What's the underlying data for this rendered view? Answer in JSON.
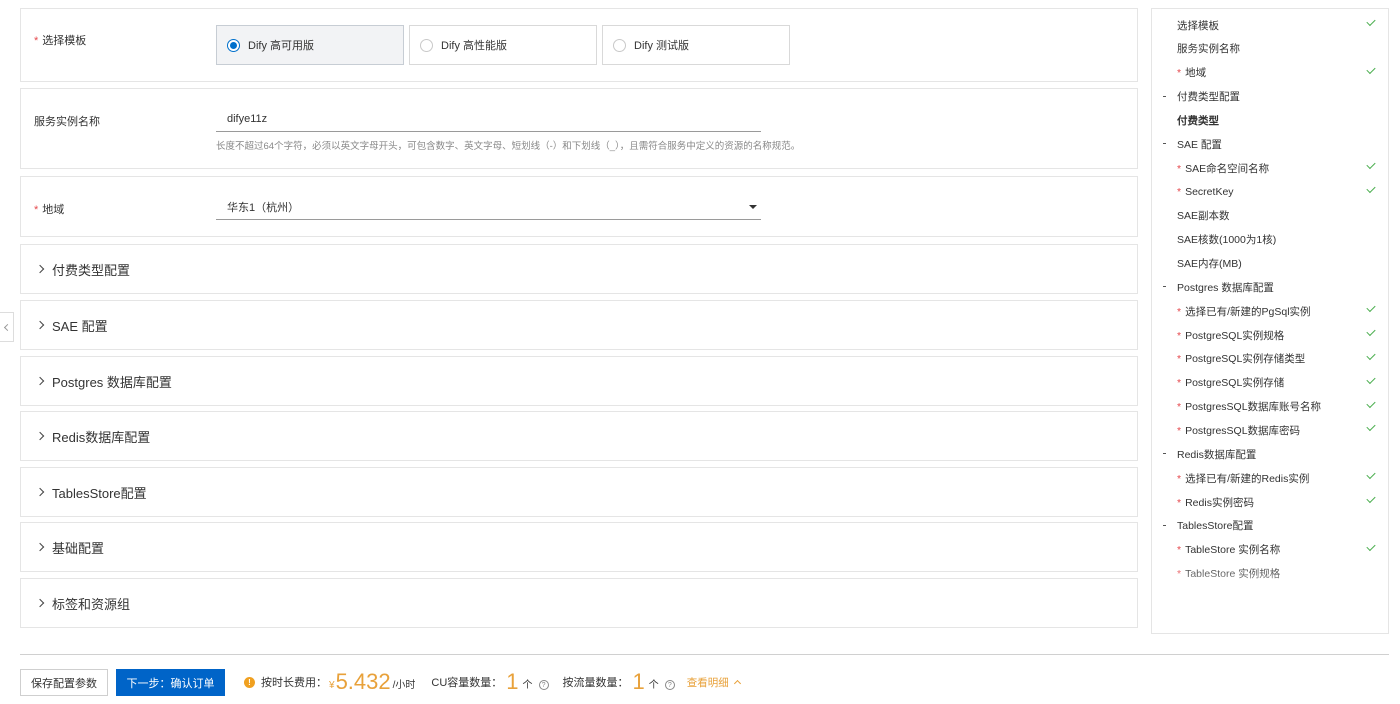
{
  "template": {
    "label": "选择模板",
    "options": [
      {
        "label": "Dify 高可用版",
        "selected": true
      },
      {
        "label": "Dify 高性能版",
        "selected": false
      },
      {
        "label": "Dify 测试版",
        "selected": false
      }
    ]
  },
  "instance_name": {
    "label": "服务实例名称",
    "value": "difye11z",
    "hint": "长度不超过64个字符，必须以英文字母开头，可包含数字、英文字母、短划线（-）和下划线（_），且需符合服务中定义的资源的名称规范。"
  },
  "region": {
    "label": "地域",
    "value": "华东1（杭州）"
  },
  "sections": [
    {
      "label": "付费类型配置"
    },
    {
      "label": "SAE 配置"
    },
    {
      "label": "Postgres 数据库配置"
    },
    {
      "label": "Redis数据库配置"
    },
    {
      "label": "TablesStore配置"
    },
    {
      "label": "基础配置"
    },
    {
      "label": "标签和资源组"
    }
  ],
  "nav": {
    "items": [
      {
        "label": "选择模板",
        "required": false,
        "checked": true,
        "group": false,
        "bold": false
      },
      {
        "label": "服务实例名称",
        "required": false,
        "checked": false,
        "group": false,
        "bold": false
      },
      {
        "label": "地域",
        "required": true,
        "checked": true,
        "group": false,
        "bold": false
      },
      {
        "label": "付费类型配置",
        "required": false,
        "checked": false,
        "group": true,
        "bold": false
      },
      {
        "label": "付费类型",
        "required": false,
        "checked": false,
        "group": false,
        "bold": true
      },
      {
        "label": "SAE 配置",
        "required": false,
        "checked": false,
        "group": true,
        "bold": false
      },
      {
        "label": "SAE命名空间名称",
        "required": true,
        "checked": true,
        "group": false,
        "bold": false
      },
      {
        "label": "SecretKey",
        "required": true,
        "checked": true,
        "group": false,
        "bold": false
      },
      {
        "label": "SAE副本数",
        "required": false,
        "checked": false,
        "group": false,
        "bold": false
      },
      {
        "label": "SAE核数(1000为1核)",
        "required": false,
        "checked": false,
        "group": false,
        "bold": false
      },
      {
        "label": "SAE内存(MB)",
        "required": false,
        "checked": false,
        "group": false,
        "bold": false
      },
      {
        "label": "Postgres 数据库配置",
        "required": false,
        "checked": false,
        "group": true,
        "bold": false
      },
      {
        "label": "选择已有/新建的PgSql实例",
        "required": true,
        "checked": true,
        "group": false,
        "bold": false
      },
      {
        "label": "PostgreSQL实例规格",
        "required": true,
        "checked": true,
        "group": false,
        "bold": false
      },
      {
        "label": "PostgreSQL实例存储类型",
        "required": true,
        "checked": true,
        "group": false,
        "bold": false
      },
      {
        "label": "PostgreSQL实例存储",
        "required": true,
        "checked": true,
        "group": false,
        "bold": false
      },
      {
        "label": "PostgresSQL数据库账号名称",
        "required": true,
        "checked": true,
        "group": false,
        "bold": false
      },
      {
        "label": "PostgresSQL数据库密码",
        "required": true,
        "checked": true,
        "group": false,
        "bold": false
      },
      {
        "label": "Redis数据库配置",
        "required": false,
        "checked": false,
        "group": true,
        "bold": false
      },
      {
        "label": "选择已有/新建的Redis实例",
        "required": true,
        "checked": true,
        "group": false,
        "bold": false
      },
      {
        "label": "Redis实例密码",
        "required": true,
        "checked": true,
        "group": false,
        "bold": false
      },
      {
        "label": "TablesStore配置",
        "required": false,
        "checked": false,
        "group": true,
        "bold": false
      },
      {
        "label": "TableStore 实例名称",
        "required": true,
        "checked": true,
        "group": false,
        "bold": false
      },
      {
        "label": "TableStore 实例规格",
        "required": true,
        "checked": false,
        "group": false,
        "bold": false
      }
    ]
  },
  "footer": {
    "save_label": "保存配置参数",
    "next_label": "下一步：确认订单",
    "fee_label": "按时长费用：",
    "currency": "¥",
    "fee_value": "5.432",
    "fee_unit": "/小时",
    "cu_label": "CU容量数量：",
    "cu_value": "1",
    "cu_unit": "个",
    "flow_label": "按流量数量：",
    "flow_value": "1",
    "flow_unit": "个",
    "detail_label": "查看明细"
  },
  "icons": {
    "warn": "info-warning-icon",
    "help": "question-circle-icon",
    "accent_orange": "#e8a13a",
    "primary_blue": "#0064c8",
    "check_green": "#4caf50"
  }
}
